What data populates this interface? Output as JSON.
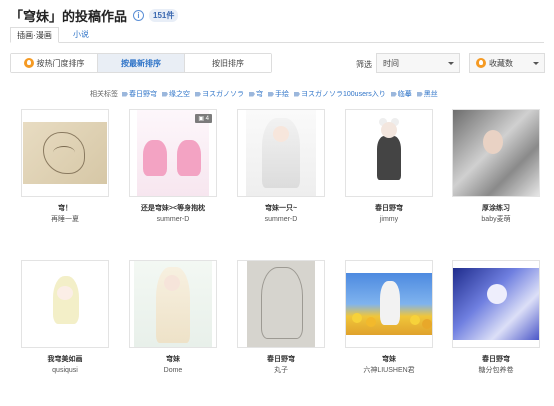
{
  "header": {
    "title": "「穹妹」的投稿作品",
    "count": "151件"
  },
  "tabs": [
    {
      "label": "插画·漫画"
    },
    {
      "label": "小说"
    }
  ],
  "sort": {
    "popular": "按热门度排序",
    "newest": "按最新排序",
    "oldest": "按旧排序"
  },
  "filter": {
    "label": "筛选",
    "time": "时间",
    "favorites": "收藏数"
  },
  "tags": {
    "label": "相关标签",
    "items": [
      "春日野穹",
      "缘之空",
      "ヨスガノソラ",
      "穹",
      "手绘",
      "ヨスガノソラ100users入り",
      "临摹",
      "黑丝"
    ]
  },
  "works": [
    {
      "title": "穹！",
      "author": "再睡一夏"
    },
    {
      "title": "还是穹妹><等身抱枕",
      "author": "summer-D",
      "pages": "4"
    },
    {
      "title": "穹妹一只~",
      "author": "summer-D"
    },
    {
      "title": "春日野穹",
      "author": "jimmy"
    },
    {
      "title": "厚涂练习",
      "author": "baby麦萌"
    },
    {
      "title": "我穹美如画",
      "author": "qusiqusi"
    },
    {
      "title": "穹妹",
      "author": "Dome"
    },
    {
      "title": "春日野穹",
      "author": "丸子"
    },
    {
      "title": "穹妹",
      "author": "六神LIUSHEN君"
    },
    {
      "title": "春日野穹",
      "author": "糖分包养卷"
    }
  ]
}
